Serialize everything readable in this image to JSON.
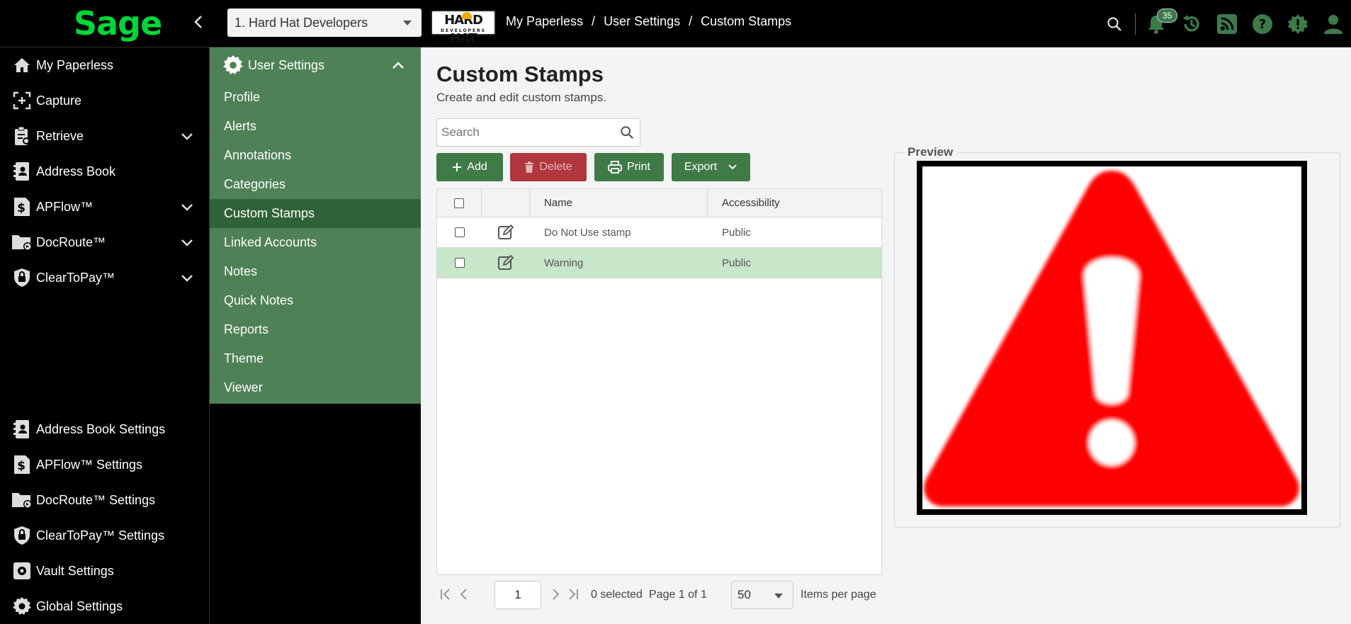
{
  "app": {
    "logo": "Sage"
  },
  "header": {
    "company": "1. Hard Hat Developers",
    "company_logo": {
      "main": "HARD HAT",
      "sub": "DEVELOPERS"
    },
    "breadcrumb": [
      "My Paperless",
      "User Settings",
      "Custom Stamps"
    ],
    "notifications_count": "35",
    "icons": [
      "search-icon",
      "bell-icon",
      "history-icon",
      "rss-icon",
      "help-icon",
      "alert-badge-icon",
      "user-icon"
    ]
  },
  "leftnav": {
    "top": [
      {
        "label": "My Paperless",
        "icon": "home-icon",
        "expandable": false
      },
      {
        "label": "Capture",
        "icon": "capture-icon",
        "expandable": false
      },
      {
        "label": "Retrieve",
        "icon": "clipboard-search-icon",
        "expandable": true
      },
      {
        "label": "Address Book",
        "icon": "address-book-icon",
        "expandable": false
      },
      {
        "label": "APFlow™",
        "icon": "dollar-doc-icon",
        "expandable": true
      },
      {
        "label": "DocRoute™",
        "icon": "folder-route-icon",
        "expandable": true
      },
      {
        "label": "ClearToPay™",
        "icon": "shield-lock-icon",
        "expandable": true
      }
    ],
    "bottom": [
      {
        "label": "Address Book Settings",
        "icon": "address-book-icon"
      },
      {
        "label": "APFlow™ Settings",
        "icon": "dollar-doc-icon"
      },
      {
        "label": "DocRoute™ Settings",
        "icon": "folder-route-icon"
      },
      {
        "label": "ClearToPay™ Settings",
        "icon": "shield-lock-icon"
      },
      {
        "label": "Vault Settings",
        "icon": "vault-gear-icon"
      },
      {
        "label": "Global Settings",
        "icon": "gear-icon"
      }
    ]
  },
  "submenu": {
    "title": "User Settings",
    "items": [
      "Profile",
      "Alerts",
      "Annotations",
      "Categories",
      "Custom Stamps",
      "Linked Accounts",
      "Notes",
      "Quick Notes",
      "Reports",
      "Theme",
      "Viewer"
    ],
    "active": "Custom Stamps"
  },
  "page": {
    "title": "Custom Stamps",
    "subtitle": "Create and edit custom stamps.",
    "search_placeholder": "Search"
  },
  "toolbar": {
    "add": "Add",
    "delete": "Delete",
    "print": "Print",
    "export": "Export"
  },
  "grid": {
    "columns": [
      "Name",
      "Accessibility"
    ],
    "rows": [
      {
        "name": "Do Not Use stamp",
        "accessibility": "Public",
        "selected": false
      },
      {
        "name": "Warning",
        "accessibility": "Public",
        "selected": true
      }
    ]
  },
  "pager": {
    "page": "1",
    "selected_text": "0 selected",
    "page_text": "Page 1 of 1",
    "per_page": "50",
    "per_page_label": "Items per page"
  },
  "preview": {
    "legend": "Preview",
    "stamp_color": "#ff0000"
  },
  "colors": {
    "brand_green": "#00d639",
    "submenu_bg": "#4e8155",
    "submenu_active": "#2f6236",
    "button_green": "#3f7a47",
    "button_red": "#b1363d",
    "row_selected": "#c8e6c9"
  }
}
